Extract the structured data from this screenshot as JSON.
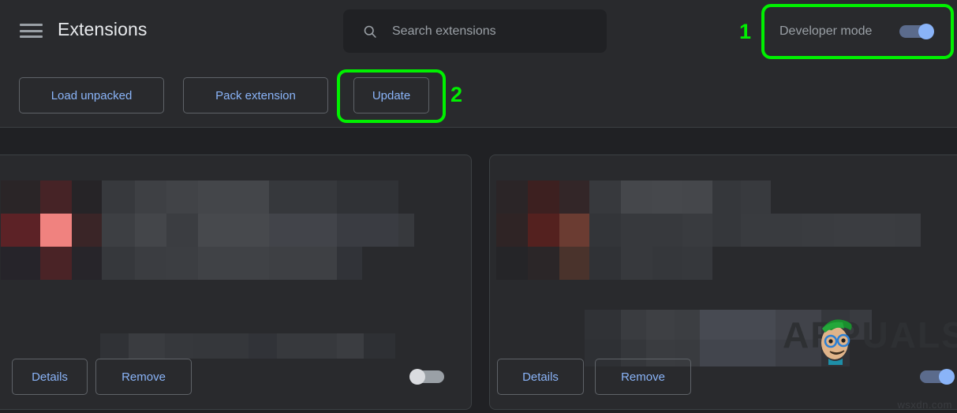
{
  "header": {
    "menu_icon": "hamburger-menu-icon",
    "title": "Extensions",
    "search": {
      "icon": "search-icon",
      "placeholder": "Search extensions",
      "value": ""
    },
    "developer_mode": {
      "label": "Developer mode",
      "state": "on",
      "annotation_number": "1"
    }
  },
  "toolbar": {
    "load_unpacked_label": "Load unpacked",
    "pack_extension_label": "Pack extension",
    "update_label": "Update",
    "update_annotation_number": "2"
  },
  "cards": [
    {
      "id": "extension-card-left",
      "name_blurred": true,
      "details_label": "Details",
      "remove_label": "Remove",
      "enabled_toggle_state": "off"
    },
    {
      "id": "extension-card-right",
      "name_blurred": true,
      "details_label": "Details",
      "remove_label": "Remove",
      "enabled_toggle_state": "on"
    }
  ],
  "watermarks": {
    "logo_text": "APPUALS",
    "bottom_right": "wsxdn.com"
  },
  "colors": {
    "page_background": "#202124",
    "surface": "#292a2d",
    "accent_link": "#8ab4f8",
    "toggle_on_track": "#5b6b8c",
    "toggle_off_track": "#9aa0a6",
    "annotation_green": "#00f000",
    "text_primary": "#e8eaed",
    "text_secondary": "#9aa0a6",
    "border": "#5f6368",
    "divider": "#3c4043"
  }
}
